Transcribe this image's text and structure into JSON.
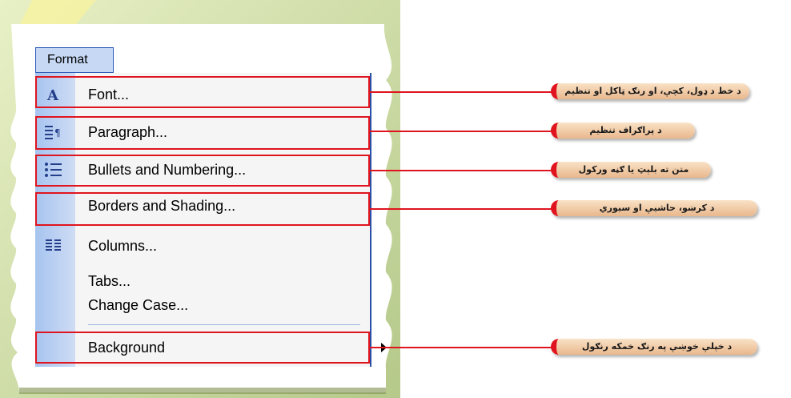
{
  "menu": {
    "title": "Format",
    "items": [
      {
        "label": "Font...",
        "icon": "font-a-icon"
      },
      {
        "label": "Paragraph...",
        "icon": "paragraph-icon"
      },
      {
        "label": "Bullets and Numbering...",
        "icon": "bullets-list-icon"
      },
      {
        "label": "Borders and Shading...",
        "icon": ""
      },
      {
        "label": "Columns...",
        "icon": "columns-icon"
      },
      {
        "label": "Tabs...",
        "icon": ""
      },
      {
        "label": "Change Case...",
        "icon": ""
      },
      {
        "label": "Background",
        "icon": "submenu-arrow-icon"
      }
    ]
  },
  "callouts": [
    "د خط د ډول، کچې، او رنګ ټاکل او تنظیم",
    "د پراګراف تنظیم",
    "متن ته بلېټ یا ګڼه ورکول",
    "د کرښو، حاشیې او سیوري",
    "د خپلې خوښې په رنګ خمکه رنګول"
  ],
  "colors": {
    "highlight": "#e0141e",
    "frame_green": "#c8d79a",
    "menu_gutter": "#a6c4f0",
    "title_border": "#2a5bb8"
  }
}
